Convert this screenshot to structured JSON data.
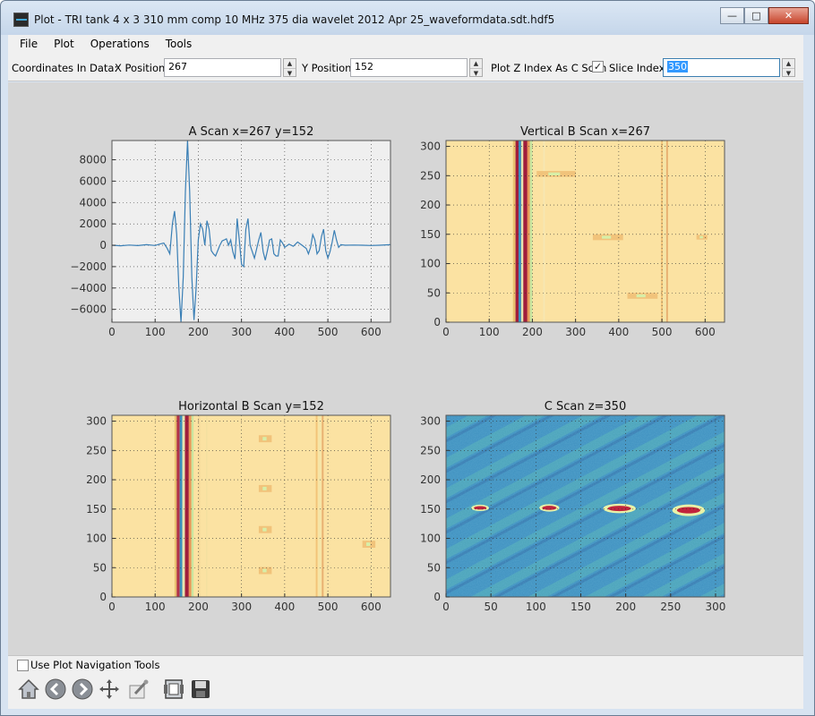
{
  "window": {
    "title": "Plot - TRI tank 4 x 3 310 mm comp 10 MHz 375 dia wavelet 2012 Apr 25_waveformdata.sdt.hdf5",
    "minimize": "—",
    "maximize": "□",
    "close": "✕"
  },
  "menu": [
    "File",
    "Plot",
    "Operations",
    "Tools"
  ],
  "toolbar": {
    "coords_label": "Coordinates In Data:",
    "x_label": "X Position",
    "x_value": "267",
    "y_label": "Y Position",
    "y_value": "152",
    "zindex_label": "Plot Z Index As C Scan",
    "zindex_checked": "✓",
    "slice_label": "Slice Index",
    "slice_value": "350"
  },
  "bottom": {
    "nav_label": "Use Plot Navigation Tools",
    "tools": [
      "home-icon",
      "back-arrow-icon",
      "forward-arrow-icon",
      "pan-icon",
      "configure-subplots-icon",
      "zoom-to-rect-icon",
      "save-icon"
    ]
  },
  "colors": {
    "line": "#3a7fb5",
    "plot_bg": "#efefef",
    "figure_bg": "#d6d6d6"
  },
  "chart_data": [
    {
      "type": "line",
      "title": "A Scan x=267 y=152",
      "xlim": [
        0,
        645
      ],
      "ylim": [
        -7200,
        9800
      ],
      "xticks": [
        0,
        100,
        200,
        300,
        400,
        500,
        600
      ],
      "yticks": [
        -6000,
        -4000,
        -2000,
        0,
        2000,
        4000,
        6000,
        8000
      ],
      "grid": true,
      "series": [
        {
          "x": [
            0,
            20,
            40,
            60,
            80,
            100,
            110,
            120,
            128,
            134,
            140,
            145,
            150,
            155,
            160,
            165,
            170,
            175,
            180,
            185,
            190,
            195,
            200,
            205,
            210,
            215,
            220,
            225,
            230,
            235,
            240,
            245,
            250,
            255,
            260,
            265,
            270,
            275,
            280,
            285,
            290,
            295,
            300,
            305,
            310,
            315,
            320,
            330,
            340,
            345,
            350,
            355,
            360,
            365,
            370,
            375,
            380,
            385,
            390,
            395,
            400,
            410,
            420,
            430,
            440,
            450,
            455,
            460,
            465,
            470,
            475,
            480,
            485,
            490,
            495,
            500,
            505,
            510,
            515,
            520,
            525,
            530,
            540,
            560,
            580,
            600,
            620,
            645
          ],
          "values": [
            0,
            -50,
            20,
            -30,
            50,
            -20,
            100,
            200,
            -300,
            -800,
            2000,
            3200,
            1000,
            -4000,
            -7200,
            -3000,
            5000,
            9800,
            5000,
            -3000,
            -7000,
            -4000,
            500,
            2000,
            1500,
            0,
            2300,
            1500,
            -500,
            -800,
            -1000,
            -500,
            0,
            400,
            500,
            600,
            0,
            500,
            -600,
            -1300,
            2500,
            500,
            -1800,
            -2000,
            1500,
            2500,
            0,
            -1200,
            500,
            1200,
            -600,
            -1400,
            -500,
            500,
            600,
            -800,
            -1000,
            -1000,
            500,
            200,
            -200,
            100,
            -100,
            300,
            0,
            -300,
            -800,
            -200,
            1000,
            500,
            -800,
            -500,
            800,
            1500,
            -500,
            -1200,
            -600,
            300,
            1400,
            500,
            -200,
            50,
            0,
            20,
            0,
            -20,
            0,
            50
          ]
        }
      ]
    },
    {
      "type": "heatmap",
      "title": "Vertical B Scan x=267",
      "xlim": [
        0,
        645
      ],
      "ylim": [
        0,
        310
      ],
      "xticks": [
        0,
        100,
        200,
        300,
        400,
        500,
        600
      ],
      "yticks": [
        0,
        50,
        100,
        150,
        200,
        250,
        300
      ],
      "grid": true,
      "bands": [
        {
          "x": 155,
          "w": 8,
          "color": "#e8c070"
        },
        {
          "x": 161,
          "w": 8,
          "color": "#a01d3c"
        },
        {
          "x": 168,
          "w": 7,
          "color": "#3b8fbd"
        },
        {
          "x": 174,
          "w": 6,
          "color": "#e8e4b0"
        },
        {
          "x": 179,
          "w": 10,
          "color": "#a01d3c"
        },
        {
          "x": 188,
          "w": 7,
          "color": "#e89858"
        },
        {
          "x": 194,
          "w": 6,
          "color": "#c9e6a0"
        },
        {
          "x": 225,
          "w": 4,
          "color": "#f6e7b2"
        },
        {
          "x": 498,
          "w": 4,
          "color": "#f2c478"
        },
        {
          "x": 503,
          "w": 6,
          "color": "#f4e6a8"
        },
        {
          "x": 510,
          "w": 4,
          "color": "#e8b070"
        }
      ],
      "features": [
        {
          "x": 210,
          "y": 253,
          "w": 90,
          "h": 10
        },
        {
          "x": 340,
          "y": 145,
          "w": 70,
          "h": 10
        },
        {
          "x": 420,
          "y": 45,
          "w": 70,
          "h": 10
        },
        {
          "x": 580,
          "y": 145,
          "w": 25,
          "h": 8
        }
      ]
    },
    {
      "type": "heatmap",
      "title": "Horizontal B Scan y=152",
      "xlim": [
        0,
        645
      ],
      "ylim": [
        0,
        310
      ],
      "xticks": [
        0,
        100,
        200,
        300,
        400,
        500,
        600
      ],
      "yticks": [
        0,
        50,
        100,
        150,
        200,
        250,
        300
      ],
      "grid": true,
      "bands": [
        {
          "x": 145,
          "w": 6,
          "color": "#e8c070"
        },
        {
          "x": 150,
          "w": 7,
          "color": "#b0334a"
        },
        {
          "x": 157,
          "w": 6,
          "color": "#3b8fbd"
        },
        {
          "x": 163,
          "w": 6,
          "color": "#e8e4b0"
        },
        {
          "x": 169,
          "w": 9,
          "color": "#a01d3c"
        },
        {
          "x": 178,
          "w": 6,
          "color": "#e89858"
        },
        {
          "x": 184,
          "w": 5,
          "color": "#c9e6a0"
        },
        {
          "x": 200,
          "w": 4,
          "color": "#f4d898"
        },
        {
          "x": 218,
          "w": 3,
          "color": "#f4e0a0"
        },
        {
          "x": 472,
          "w": 4,
          "color": "#f2c478"
        },
        {
          "x": 478,
          "w": 6,
          "color": "#f4e6a8"
        },
        {
          "x": 486,
          "w": 4,
          "color": "#e8b070"
        }
      ],
      "features": [
        {
          "x": 340,
          "y": 270,
          "w": 30,
          "h": 12
        },
        {
          "x": 340,
          "y": 185,
          "w": 30,
          "h": 12
        },
        {
          "x": 340,
          "y": 115,
          "w": 30,
          "h": 12
        },
        {
          "x": 340,
          "y": 45,
          "w": 30,
          "h": 12
        },
        {
          "x": 580,
          "y": 90,
          "w": 30,
          "h": 12
        }
      ]
    },
    {
      "type": "heatmap",
      "title": "C Scan z=350",
      "xlim": [
        0,
        310
      ],
      "ylim": [
        0,
        310
      ],
      "xticks": [
        0,
        50,
        100,
        150,
        200,
        250,
        300
      ],
      "yticks": [
        0,
        50,
        100,
        150,
        200,
        250,
        300
      ],
      "grid": true,
      "defects": [
        {
          "x": 38,
          "y": 152,
          "w": 14,
          "h": 6
        },
        {
          "x": 115,
          "y": 152,
          "w": 16,
          "h": 7
        },
        {
          "x": 193,
          "y": 151,
          "w": 26,
          "h": 9
        },
        {
          "x": 270,
          "y": 148,
          "w": 26,
          "h": 11
        }
      ]
    }
  ]
}
